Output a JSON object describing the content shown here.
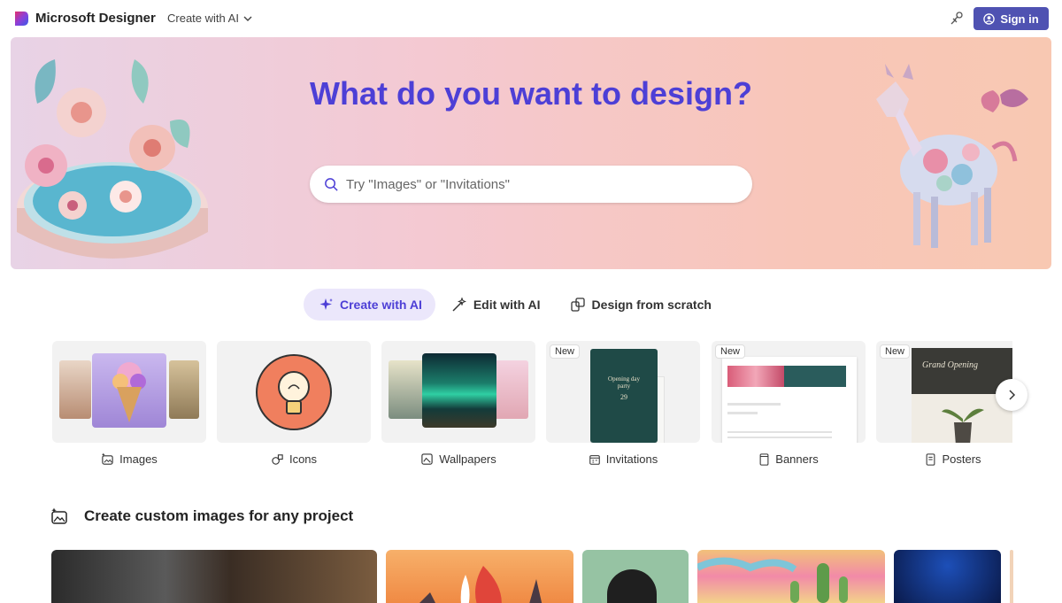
{
  "header": {
    "brand": "Microsoft Designer",
    "create_menu_label": "Create with AI",
    "signin_label": "Sign in"
  },
  "hero": {
    "title": "What do you want to design?",
    "search_placeholder": "Try \"Images\" or \"Invitations\""
  },
  "modes": [
    {
      "label": "Create with AI",
      "active": true
    },
    {
      "label": "Edit with AI",
      "active": false
    },
    {
      "label": "Design from scratch",
      "active": false
    }
  ],
  "categories": [
    {
      "label": "Images",
      "is_new": false
    },
    {
      "label": "Icons",
      "is_new": false
    },
    {
      "label": "Wallpapers",
      "is_new": false
    },
    {
      "label": "Invitations",
      "is_new": true
    },
    {
      "label": "Banners",
      "is_new": true
    },
    {
      "label": "Posters",
      "is_new": true
    }
  ],
  "new_badge": "New",
  "invitation_card": {
    "line1": "Opening day",
    "line2": "party",
    "day": "29"
  },
  "poster_card": {
    "title": "Grand Opening"
  },
  "section": {
    "title": "Create custom images for any project"
  },
  "colors": {
    "accent": "#4f52b2",
    "hero_title": "#4d3fd6"
  }
}
